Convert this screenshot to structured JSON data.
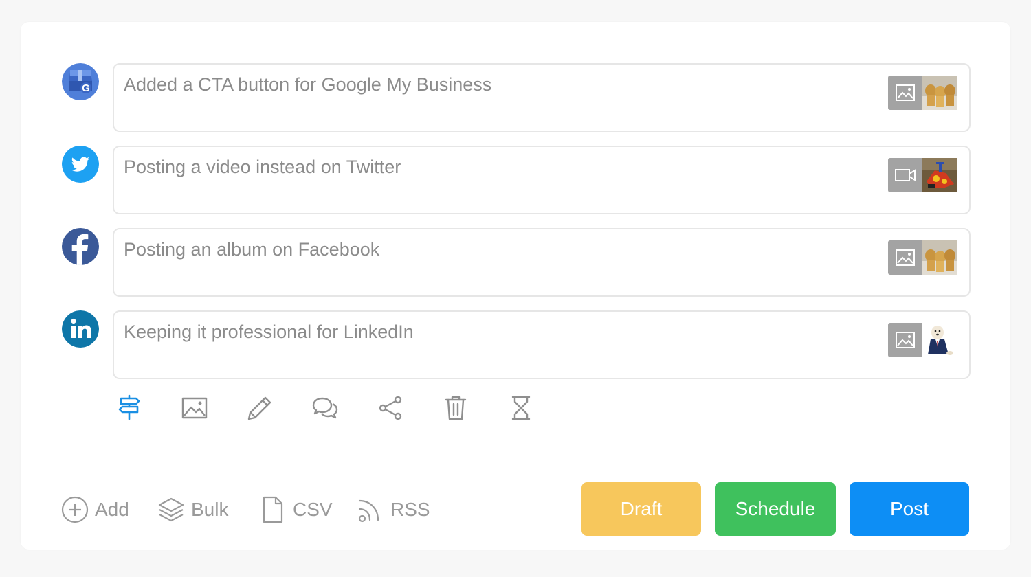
{
  "posts": [
    {
      "network_icon": "google-my-business-icon",
      "text": "Added a CTA button for Google My Business",
      "media_type_icon": "image-icon",
      "thumbnail": "puppies-photo"
    },
    {
      "network_icon": "twitter-icon",
      "text": "Posting a video instead on Twitter",
      "media_type_icon": "video-icon",
      "thumbnail": "toy-scene-photo"
    },
    {
      "network_icon": "facebook-icon",
      "text": "Posting an album on Facebook",
      "media_type_icon": "image-icon",
      "thumbnail": "puppies-photo"
    },
    {
      "network_icon": "linkedin-icon",
      "text": "Keeping it professional for LinkedIn",
      "media_type_icon": "image-icon",
      "thumbnail": "dog-in-suit-photo"
    }
  ],
  "toolbar": [
    {
      "icon": "signpost-icon",
      "active": true
    },
    {
      "icon": "image-icon",
      "active": false
    },
    {
      "icon": "pencil-icon",
      "active": false
    },
    {
      "icon": "comments-icon",
      "active": false
    },
    {
      "icon": "share-icon",
      "active": false
    },
    {
      "icon": "trash-icon",
      "active": false
    },
    {
      "icon": "hourglass-icon",
      "active": false
    }
  ],
  "footer": {
    "add_label": "Add",
    "bulk_label": "Bulk",
    "csv_label": "CSV",
    "rss_label": "RSS"
  },
  "actions": {
    "draft_label": "Draft",
    "schedule_label": "Schedule",
    "post_label": "Post"
  },
  "colors": {
    "draft": "#f7c75c",
    "schedule": "#3fc15d",
    "post": "#0d8ef5",
    "active_tool": "#1a8fe3",
    "muted": "#9a9a9a"
  }
}
